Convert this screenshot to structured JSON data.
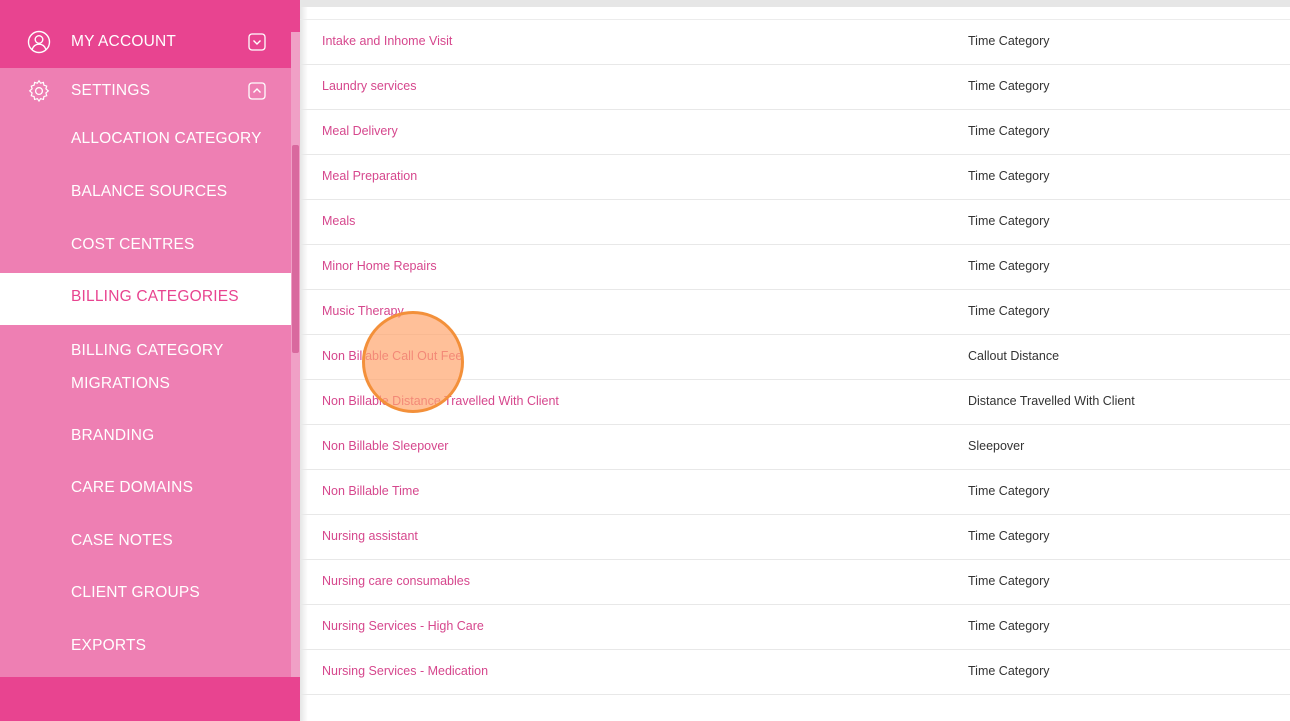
{
  "sidebar": {
    "my_account": {
      "label": "MY ACCOUNT",
      "icon": "user-circle-icon",
      "caret": "chevron-down-icon"
    },
    "settings": {
      "label": "SETTINGS",
      "icon": "gear-icon",
      "caret": "chevron-up-icon"
    },
    "items": [
      {
        "label": "ALLOCATION CATEGORY"
      },
      {
        "label": "BALANCE SOURCES"
      },
      {
        "label": "COST CENTRES"
      },
      {
        "label": "BILLING CATEGORIES",
        "active": true
      },
      {
        "label": "BILLING CATEGORY MIGRATIONS"
      },
      {
        "label": "BRANDING"
      },
      {
        "label": "CARE DOMAINS"
      },
      {
        "label": "CASE NOTES"
      },
      {
        "label": "CLIENT GROUPS"
      },
      {
        "label": "EXPORTS"
      }
    ]
  },
  "table": {
    "rows": [
      {
        "name": "Intake and Inhome Visit",
        "type": "Time Category"
      },
      {
        "name": "Laundry services",
        "type": "Time Category"
      },
      {
        "name": "Meal Delivery",
        "type": "Time Category"
      },
      {
        "name": "Meal Preparation",
        "type": "Time Category"
      },
      {
        "name": "Meals",
        "type": "Time Category"
      },
      {
        "name": "Minor Home Repairs",
        "type": "Time Category"
      },
      {
        "name": "Music Therapy",
        "type": "Time Category"
      },
      {
        "name": "Non Billable Call Out Fee",
        "type": "Callout Distance"
      },
      {
        "name": "Non Billable Distance Travelled With Client",
        "type": "Distance Travelled With Client"
      },
      {
        "name": "Non Billable Sleepover",
        "type": "Sleepover"
      },
      {
        "name": "Non Billable Time",
        "type": "Time Category"
      },
      {
        "name": "Nursing assistant",
        "type": "Time Category"
      },
      {
        "name": "Nursing care consumables",
        "type": "Time Category"
      },
      {
        "name": "Nursing Services - High Care",
        "type": "Time Category"
      },
      {
        "name": "Nursing Services - Medication",
        "type": "Time Category"
      }
    ]
  },
  "colors": {
    "sidebar_bg": "#ee7fb3",
    "sidebar_header": "#e84490",
    "link": "#d6478d",
    "click_marker": "#f3903a"
  }
}
